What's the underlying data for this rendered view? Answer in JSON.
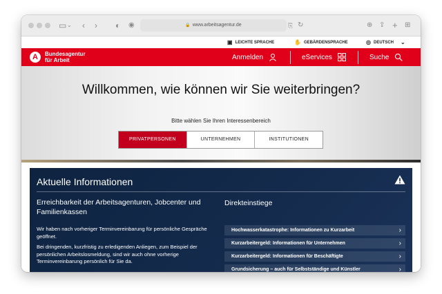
{
  "browser": {
    "url": "www.arbeitsagentur.de"
  },
  "utility": {
    "leichte": "LEICHTE SPRACHE",
    "gebaerden": "GEBÄRDENSPRACHE",
    "lang": "DEUTSCH"
  },
  "header": {
    "logo_line1": "Bundesagentur",
    "logo_line2": "für Arbeit",
    "login": "Anmelden",
    "eservices": "eServices",
    "search": "Suche"
  },
  "hero": {
    "title": "Willkommen, wie können wir Sie weiterbringen?",
    "subtitle": "Bitte wählen Sie Ihren Interessenbereich",
    "tabs": [
      "PRIVATPERSONEN",
      "UNTERNEHMEN",
      "INSTITUTIONEN"
    ]
  },
  "info": {
    "title": "Aktuelle Informationen",
    "headline": "Erreichbarkeit der Arbeitsagenturen, Jobcenter und Familienkassen",
    "para1": "Wir haben nach vorheriger Terminvereinbarung für persönliche Gespräche geöffnet.",
    "para2": "Bei dringenden, kurzfristig zu erledigenden Anliegen, zum Beispiel der persönlichen Arbeitslosmeldung, sind wir auch ohne vorherige Terminvereinbarung persönlich für Sie da.",
    "direkt_title": "Direkteinstiege",
    "links": [
      "Hochwasserkatastrophe: Informationen zu Kurzarbeit",
      "Kurzarbeitergeld: Informationen für Unternehmen",
      "Kurzarbeitergeld: Informationen für Beschäftigte",
      "Grundsicherung – auch für Selbstständige und Künstler"
    ]
  }
}
